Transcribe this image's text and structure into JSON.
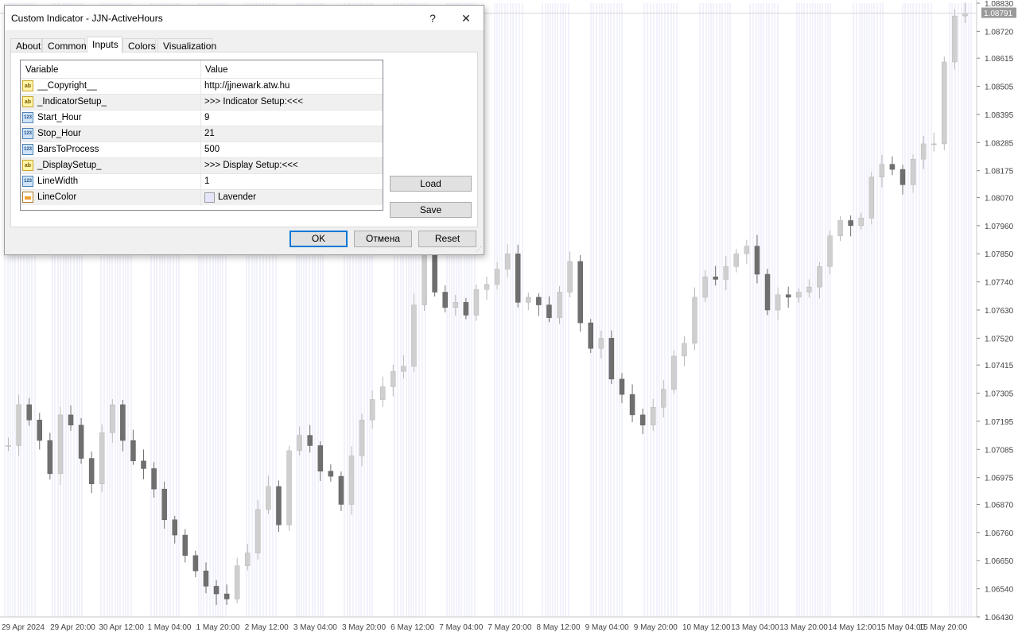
{
  "chart_data": {
    "type": "candlestick",
    "symbol_last_price": "1.08791",
    "y_ticks": [
      "1.08830",
      "1.08720",
      "1.08615",
      "1.08505",
      "1.08395",
      "1.08285",
      "1.08175",
      "1.08070",
      "1.07960",
      "1.07850",
      "1.07740",
      "1.07630",
      "1.07520",
      "1.07415",
      "1.07305",
      "1.07195",
      "1.07085",
      "1.06975",
      "1.06870",
      "1.06760",
      "1.06650",
      "1.06540",
      "1.06430"
    ],
    "x_ticks": [
      "29 Apr 2024",
      "29 Apr 20:00",
      "30 Apr 12:00",
      "1 May 04:00",
      "1 May 20:00",
      "2 May 12:00",
      "3 May 04:00",
      "3 May 20:00",
      "6 May 12:00",
      "7 May 04:00",
      "7 May 20:00",
      "8 May 12:00",
      "9 May 04:00",
      "9 May 20:00",
      "10 May 12:00",
      "13 May 04:00",
      "13 May 20:00",
      "14 May 12:00",
      "15 May 04:00",
      "15 May 20:00"
    ],
    "ylim": [
      1.0643,
      1.0883
    ],
    "highlight_color": "#e6e6fa",
    "closes": [
      1.071,
      1.0726,
      1.072,
      1.0712,
      1.0699,
      1.0722,
      1.0718,
      1.0705,
      1.0695,
      1.0715,
      1.0726,
      1.0712,
      1.0704,
      1.0701,
      1.0693,
      1.0681,
      1.0675,
      1.0667,
      1.0661,
      1.0655,
      1.0652,
      1.065,
      1.0663,
      1.0668,
      1.0685,
      1.0694,
      1.0679,
      1.0708,
      1.0714,
      1.071,
      1.07,
      1.0698,
      1.0687,
      1.0706,
      1.072,
      1.0728,
      1.0733,
      1.0739,
      1.0741,
      1.0765,
      1.0792,
      1.077,
      1.0764,
      1.0766,
      1.0761,
      1.0771,
      1.0773,
      1.0779,
      1.0785,
      1.0766,
      1.0768,
      1.0765,
      1.076,
      1.077,
      1.0782,
      1.0758,
      1.0748,
      1.0752,
      1.0736,
      1.073,
      1.0722,
      1.0718,
      1.0725,
      1.0732,
      1.0745,
      1.075,
      1.0768,
      1.0776,
      1.0775,
      1.078,
      1.0785,
      1.0788,
      1.0777,
      1.0763,
      1.0769,
      1.0768,
      1.077,
      1.0772,
      1.078,
      1.0792,
      1.0798,
      1.0796,
      1.0799,
      1.0815,
      1.082,
      1.0818,
      1.0812,
      1.0822,
      1.0828,
      1.0828,
      1.086,
      1.0878,
      1.0879
    ]
  },
  "dialog": {
    "title": "Custom Indicator - JJN-ActiveHours",
    "help_glyph": "?",
    "close_glyph": "✕",
    "tabs": [
      "About",
      "Common",
      "Inputs",
      "Colors",
      "Visualization"
    ],
    "active_tab": "Inputs",
    "columns": {
      "variable": "Variable",
      "value": "Value"
    },
    "rows": [
      {
        "type": "ab",
        "icon_text": "ab",
        "variable": "__Copyright__",
        "value": "http://jjnewark.atw.hu"
      },
      {
        "type": "ab",
        "icon_text": "ab",
        "variable": "_IndicatorSetup_",
        "value": ">>> Indicator Setup:<<<"
      },
      {
        "type": "num",
        "icon_text": "123",
        "variable": "Start_Hour",
        "value": "9"
      },
      {
        "type": "num",
        "icon_text": "123",
        "variable": "Stop_Hour",
        "value": "21"
      },
      {
        "type": "num",
        "icon_text": "123",
        "variable": "BarsToProcess",
        "value": "500"
      },
      {
        "type": "ab",
        "icon_text": "ab",
        "variable": "_DisplaySetup_",
        "value": ">>> Display Setup:<<<"
      },
      {
        "type": "num",
        "icon_text": "123",
        "variable": "LineWidth",
        "value": "1"
      },
      {
        "type": "color",
        "icon_text": "",
        "variable": "LineColor",
        "value": "Lavender",
        "swatch": "#e6e6fa"
      }
    ],
    "load_label": "Load",
    "save_label": "Save",
    "ok_label": "OK",
    "cancel_label": "Отмена",
    "reset_label": "Reset"
  }
}
